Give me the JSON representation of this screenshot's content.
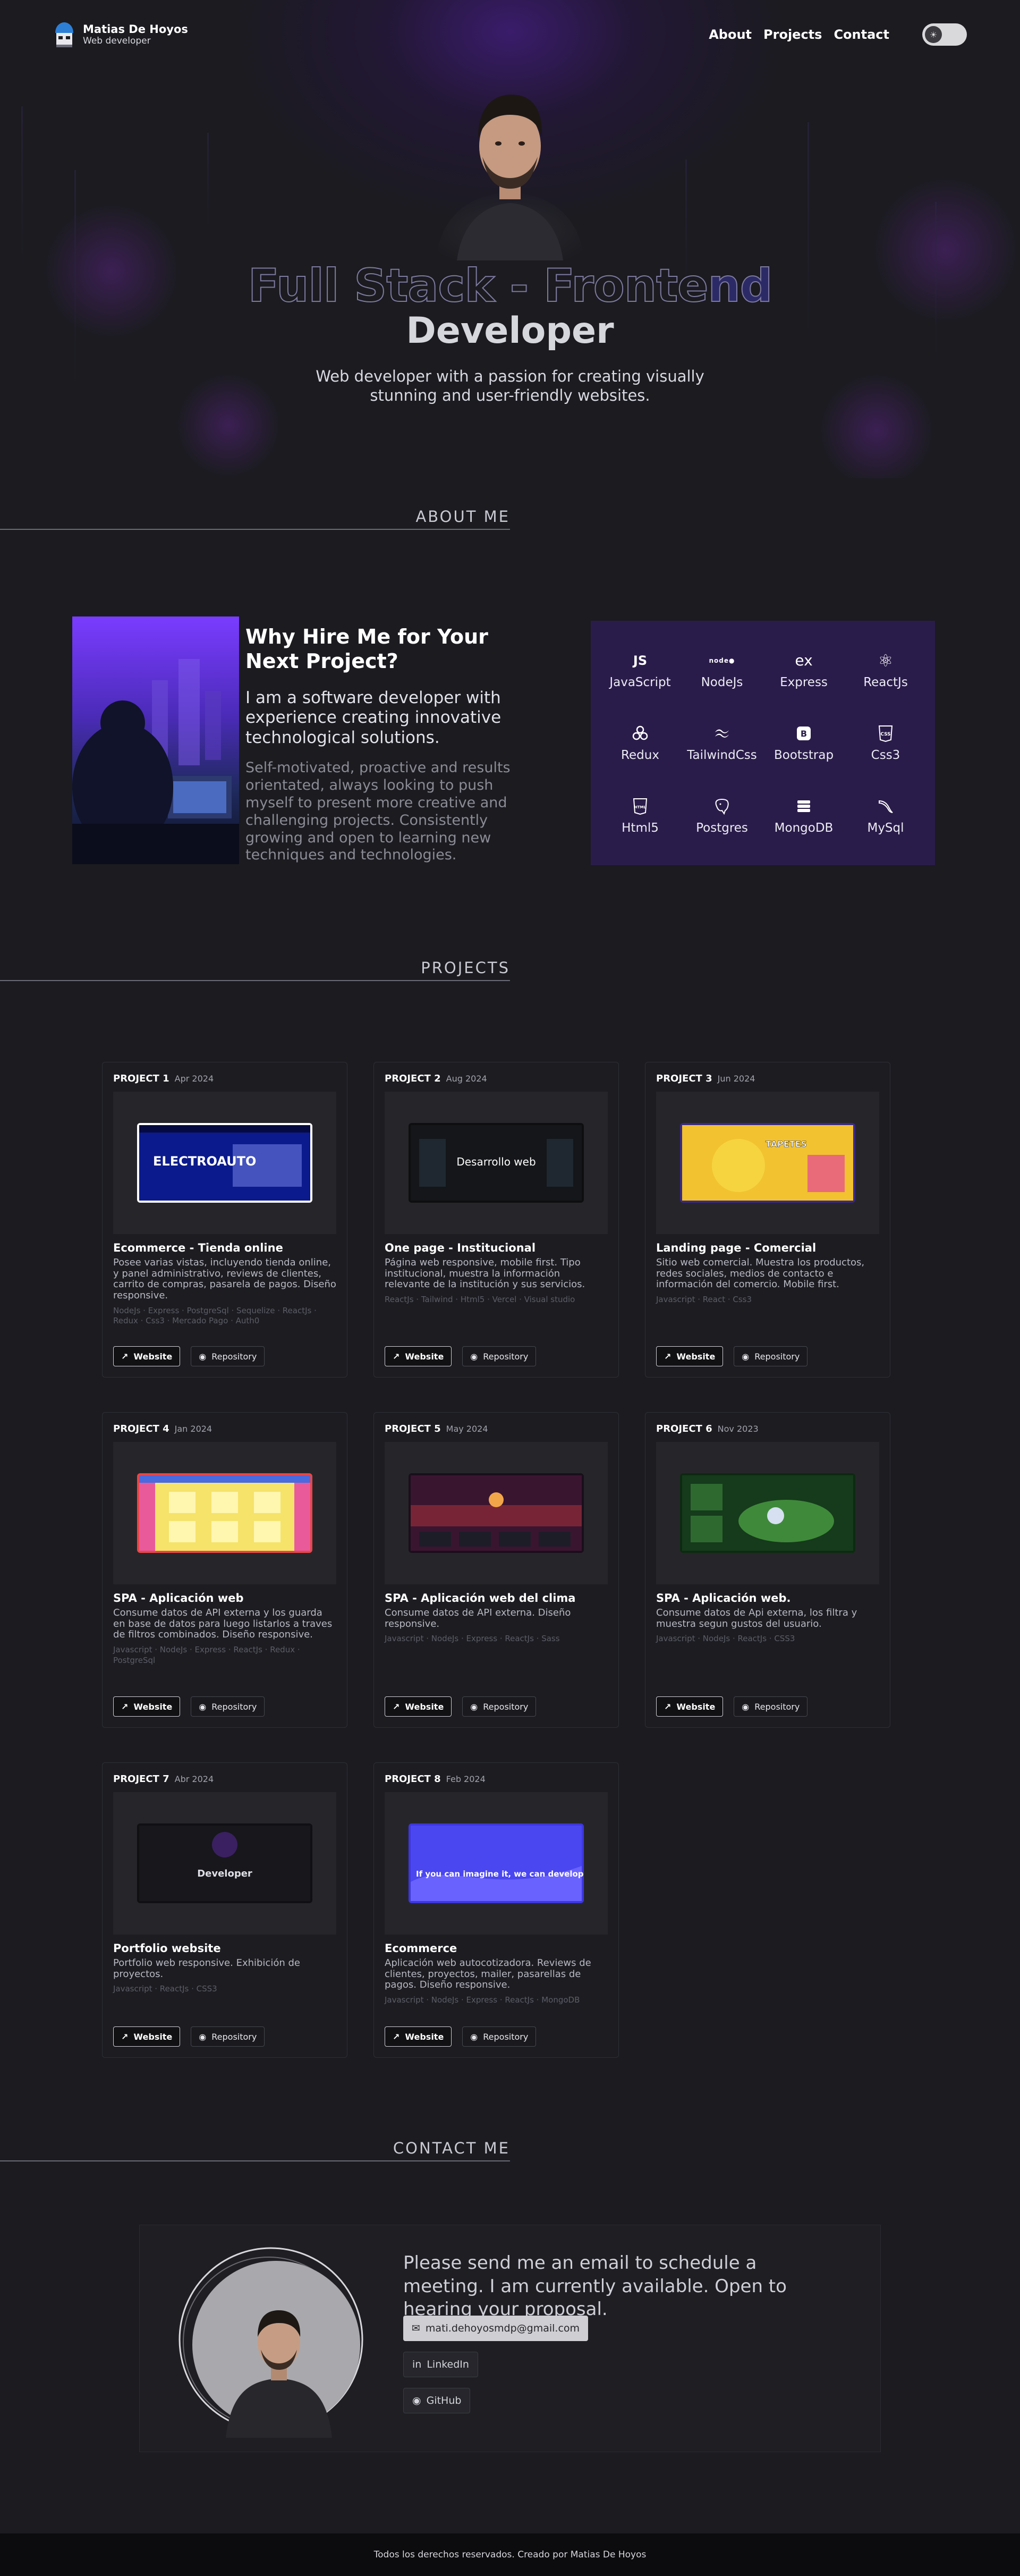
{
  "header": {
    "name": "Matias De Hoyos",
    "role": "Web developer",
    "nav": [
      {
        "label": "About"
      },
      {
        "label": "Projects"
      },
      {
        "label": "Contact"
      }
    ],
    "theme_toggle_icon": "sun-icon"
  },
  "hero": {
    "title_part1": "Full Stack - Fronte",
    "title_part2": "nd",
    "subtitle": "Developer",
    "description": "Web developer with a passion for creating visually stunning and user-friendly websites."
  },
  "about": {
    "section_title": "ABOUT ME",
    "heading": "Why Hire Me for Your Next Project?",
    "intro": "I am a software developer with experience creating innovative technological solutions.",
    "detail": "Self-motivated, proactive and results orientated, always looking to push myself to present more creative and challenging projects. Consistently growing and open to learning new techniques and technologies.",
    "skills": [
      {
        "label": "JavaScript",
        "icon": "JS"
      },
      {
        "label": "NodeJs",
        "icon": "node"
      },
      {
        "label": "Express",
        "icon": "ex"
      },
      {
        "label": "ReactJs",
        "icon": "⚛"
      },
      {
        "label": "Redux",
        "icon": "redux"
      },
      {
        "label": "TailwindCss",
        "icon": "tailwind"
      },
      {
        "label": "Bootstrap",
        "icon": "B"
      },
      {
        "label": "Css3",
        "icon": "CSS"
      },
      {
        "label": "Html5",
        "icon": "HTML"
      },
      {
        "label": "Postgres",
        "icon": "elephant"
      },
      {
        "label": "MongoDB",
        "icon": "db"
      },
      {
        "label": "MySql",
        "icon": "dolphin"
      }
    ]
  },
  "projects": {
    "section_title": "PROJECTS",
    "website_label": "Website",
    "repo_label": "Repository",
    "items": [
      {
        "num": "PROJECT 1",
        "date": "Apr 2024",
        "title": "Ecommerce - Tienda online",
        "desc": "Posee varias vistas, incluyendo tienda online, y panel administrativo, reviews de clientes, carrito de compras, pasarela de pagos. Diseño responsive.",
        "tech": "NodeJs · Express · PostgreSql · Sequelize · ReactJs · Redux · Css3 · Mercado Pago · Auth0",
        "shot_text": "ELECTROAUTO"
      },
      {
        "num": "PROJECT 2",
        "date": "Aug 2024",
        "title": "One page - Institucional",
        "desc": "Página web responsive, mobile first. Tipo institucional, muestra la información relevante de la institución y sus servicios.",
        "tech": "ReactJs · Tailwind · Html5 · Vercel · Visual studio",
        "shot_text": "Desarrollo web"
      },
      {
        "num": "PROJECT 3",
        "date": "Jun 2024",
        "title": "Landing page - Comercial",
        "desc": "Sitio web comercial. Muestra los productos, redes sociales, medios de contacto e información del comercio. Mobile first.",
        "tech": "Javascript · React · Css3",
        "shot_text": "TAPETES"
      },
      {
        "num": "PROJECT 4",
        "date": "Jan 2024",
        "title": "SPA - Aplicación web",
        "desc": "Consume datos de API externa y los guarda en base de datos para luego listarlos a traves de filtros combinados. Diseño responsive.",
        "tech": "Javascript · NodeJs · Express · ReactJs · Redux · PostgreSql",
        "shot_text": ""
      },
      {
        "num": "PROJECT 5",
        "date": "May 2024",
        "title": "SPA - Aplicación web del clima",
        "desc": "Consume datos de API externa. Diseño responsive.",
        "tech": "Javascript · NodeJs · Express · ReactJs · Sass",
        "shot_text": ""
      },
      {
        "num": "PROJECT 6",
        "date": "Nov 2023",
        "title": "SPA - Aplicación web.",
        "desc": "Consume datos de Api externa, los filtra y muestra segun gustos del usuario.",
        "tech": "Javascript · NodeJs · ReactJs · CSS3",
        "shot_text": ""
      },
      {
        "num": "PROJECT 7",
        "date": "Abr 2024",
        "title": "Portfolio website",
        "desc": "Portfolio web responsive. Exhibición de proyectos.",
        "tech": "Javascript · ReactJs · CSS3",
        "shot_text": "Developer"
      },
      {
        "num": "PROJECT 8",
        "date": "Feb 2024",
        "title": "Ecommerce",
        "desc": "Aplicación web autocotizadora. Reviews de clientes, proyectos, mailer, pasarellas de pagos. Diseño responsive.",
        "tech": "Javascript · NodeJs · Express · ReactJs · MongoDB",
        "shot_text": "If you can imagine it, we can develop it"
      }
    ]
  },
  "contact": {
    "section_title": "CONTACT ME",
    "message": "Please send me an email to schedule a meeting. I am currently available. Open to hearing your proposal.",
    "email": "mati.dehoyosmdp@gmail.com",
    "linkedin": "LinkedIn",
    "github": "GitHub"
  },
  "footer": {
    "text": "Todos los derechos reservados. Creado por Matias De Hoyos"
  }
}
